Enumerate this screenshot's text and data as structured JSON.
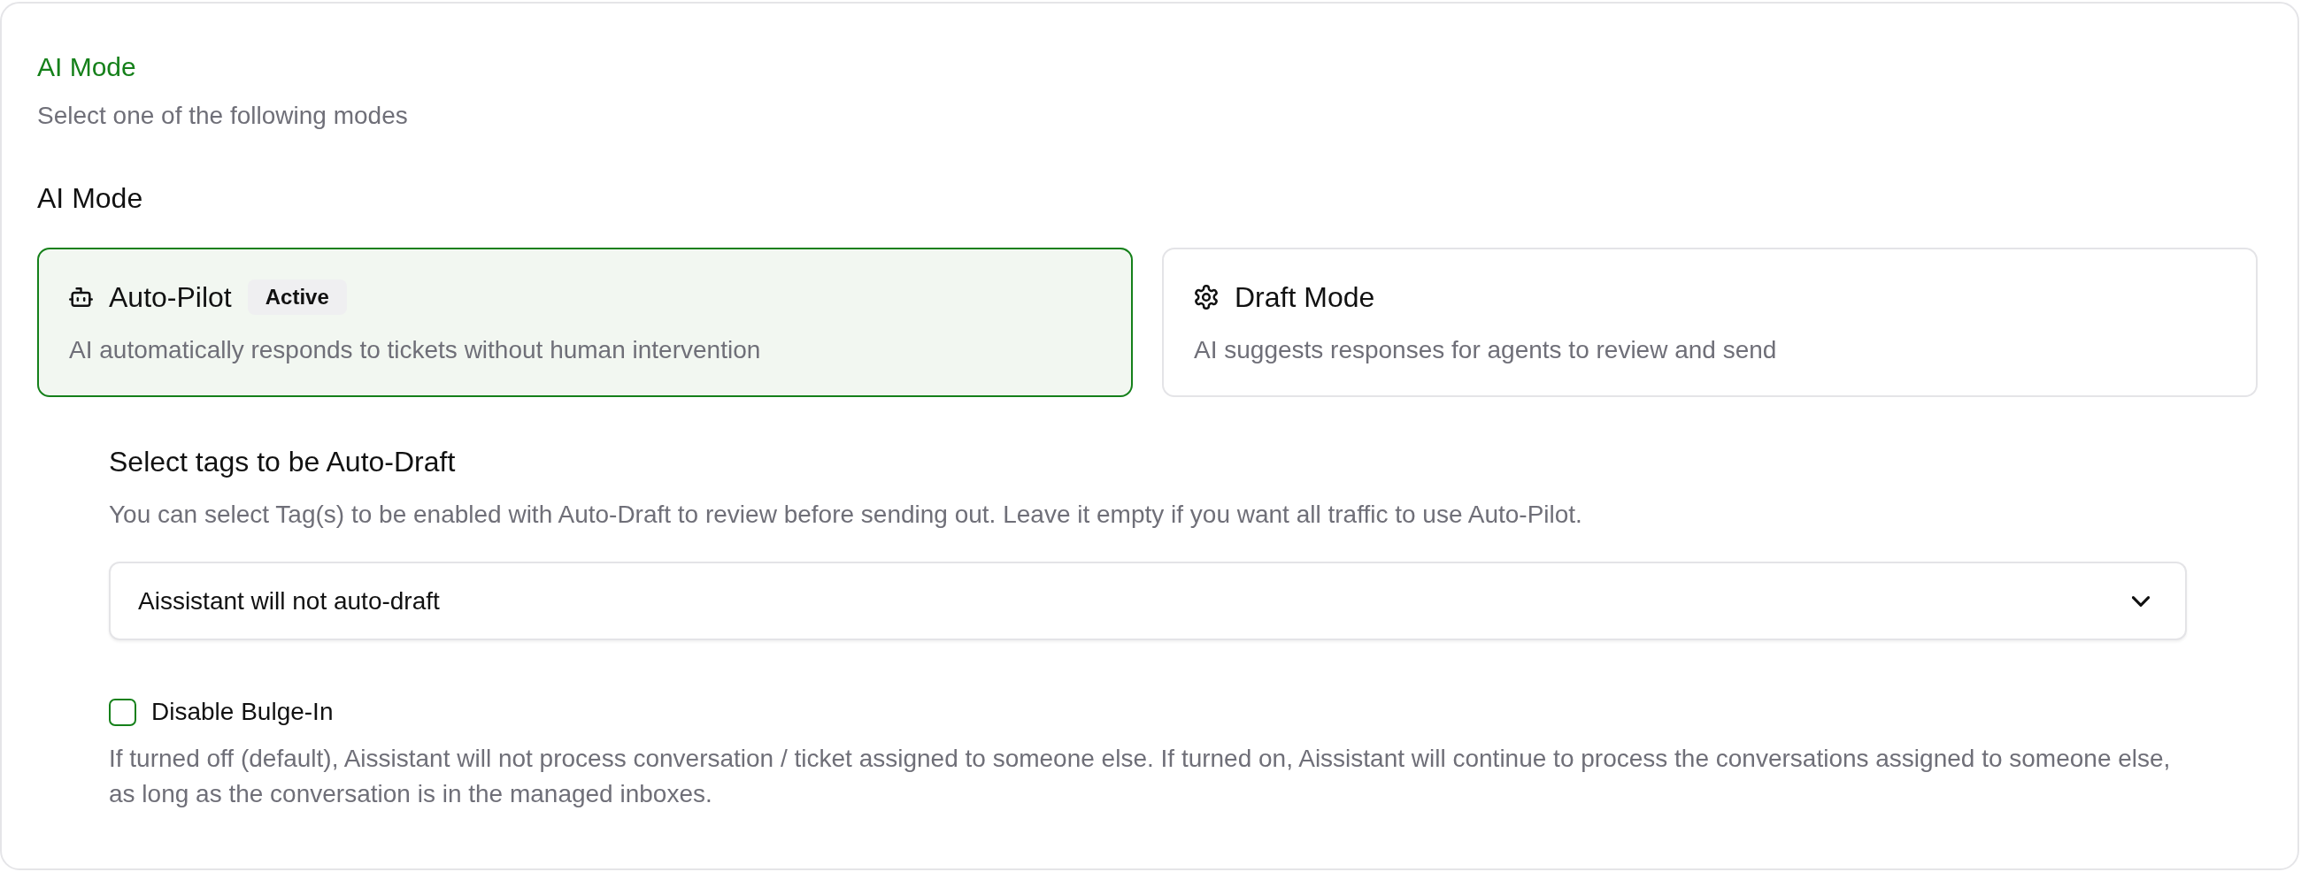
{
  "header": {
    "title": "AI Mode",
    "subtitle": "Select one of the following modes"
  },
  "mode_picker": {
    "label": "AI Mode",
    "options": [
      {
        "kind": "autopilot",
        "title": "Auto-Pilot",
        "badge": "Active",
        "description": "AI automatically responds to tickets without human intervention",
        "selected": true
      },
      {
        "kind": "draft",
        "title": "Draft Mode",
        "description": "AI suggests responses for agents to review and send",
        "selected": false
      }
    ]
  },
  "auto_draft": {
    "title": "Select tags to be Auto-Draft",
    "description": "You can select Tag(s) to be enabled with Auto-Draft to review before sending out. Leave it empty if you want all traffic to use Auto-Pilot.",
    "tag_select": {
      "value": "Aissistant will not auto-draft"
    }
  },
  "bulge_in": {
    "label": "Disable Bulge-In",
    "checked": false,
    "help": "If turned off (default), Aissistant will not process conversation / ticket assigned to someone else. If turned on, Aissistant will continue to process the conversations assigned to someone else, as long as the conversation is in the managed inboxes."
  }
}
